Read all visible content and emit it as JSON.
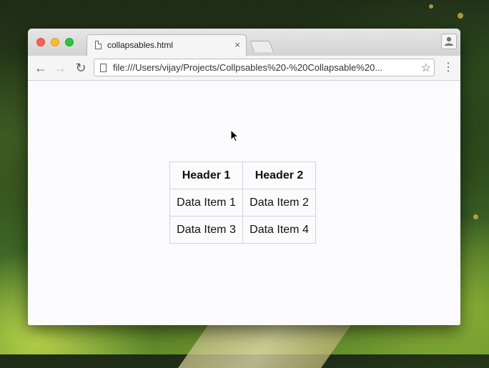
{
  "browser": {
    "tab": {
      "title": "collapsables.html",
      "close_glyph": "×"
    },
    "address_bar": {
      "url": "file:///Users/vijay/Projects/Collpsables%20-%20Collapsable%20..."
    },
    "icons": {
      "back": "←",
      "forward": "→",
      "reload": "↻",
      "star": "☆",
      "menu": "⋮"
    }
  },
  "page": {
    "table": {
      "headers": [
        "Header 1",
        "Header 2"
      ],
      "rows": [
        [
          "Data Item 1",
          "Data Item 2"
        ],
        [
          "Data Item 3",
          "Data Item 4"
        ]
      ]
    }
  },
  "colors": {
    "close": "#fc5f57",
    "minimize": "#fdbc2e",
    "maximize": "#28c840"
  }
}
